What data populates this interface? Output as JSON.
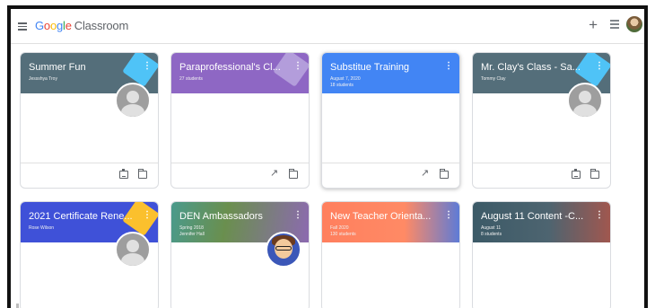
{
  "app": {
    "brand_google": [
      "G",
      "o",
      "o",
      "g",
      "l",
      "e"
    ],
    "brand_classroom": "Classroom"
  },
  "toolbar": {
    "plus_label": "+"
  },
  "cards": [
    {
      "title": "Summer Fun",
      "sub1": "Jessshya Troy",
      "sub2": "",
      "color": "#546e7a",
      "deco_color": "#4fc3f7",
      "owner": "silhouette",
      "footer": [
        "assignment-icon",
        "folder-icon"
      ]
    },
    {
      "title": "Paraprofessional's Cl...",
      "sub1": "27 students",
      "sub2": "",
      "color": "#8e67c4",
      "deco_color": "#b39ddb",
      "owner": "none",
      "footer": [
        "trending-icon",
        "folder-icon"
      ]
    },
    {
      "title": "Substitue Training",
      "sub1": "August 7, 2020",
      "sub2": "18 students",
      "color": "#4285f4",
      "deco_color": "",
      "owner": "none",
      "footer": [
        "trending-icon",
        "folder-icon"
      ]
    },
    {
      "title": "Mr. Clay's Class - Sa...",
      "sub1": "Tommy Clay",
      "sub2": "",
      "color": "#546e7a",
      "deco_color": "#4fc3f7",
      "owner": "silhouette",
      "footer": [
        "assignment-icon",
        "folder-icon"
      ]
    },
    {
      "title": "2021 Certificate Rene...",
      "sub1": "Rose Wilson",
      "sub2": "",
      "color": "#3f51d8",
      "deco_color": "#fbc02d",
      "owner": "silhouette",
      "footer": []
    },
    {
      "title": "DEN Ambassadors",
      "sub1": "Spring 2018",
      "sub2": "Jennifer Hall",
      "color": "#4a9a8c",
      "deco_color": "",
      "owner": "bitmoji",
      "footer": []
    },
    {
      "title": "New Teacher Orienta...",
      "sub1": "Fall 2020",
      "sub2": "130 students",
      "color": "#ff7f5e",
      "deco_color": "",
      "owner": "none",
      "footer": []
    },
    {
      "title": "August 11 Content -C...",
      "sub1": "August 11",
      "sub2": "8 students",
      "color": "#3c5a67",
      "deco_color": "",
      "owner": "none",
      "footer": []
    }
  ]
}
